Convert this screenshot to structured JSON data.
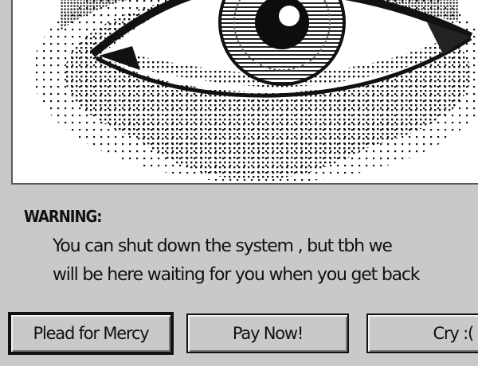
{
  "warning": {
    "title": "WARNING:",
    "line1": "You can shut down the system , but tbh we",
    "line2": "will be here waiting for you when you get back"
  },
  "buttons": {
    "mercy": "Plead for Mercy",
    "pay": "Pay Now!",
    "cry": "Cry :("
  },
  "colors": {
    "window": "#c9c9c9",
    "text": "#111111",
    "panel": "#ffffff"
  },
  "image": {
    "subject": "eye-icon"
  }
}
